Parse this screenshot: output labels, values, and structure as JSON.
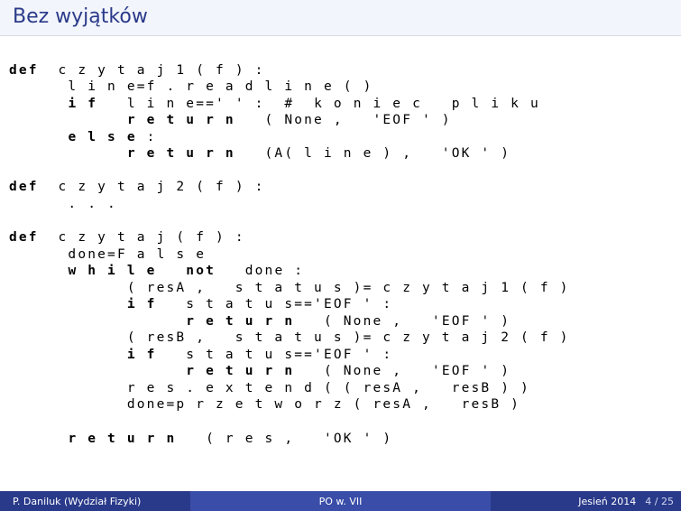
{
  "title": "Bez wyjątków",
  "code": {
    "lines": [
      "def  czytaj1 ( f ) :",
      "     line=f . readline ()",
      "     if  line=='': # koniec  pliku",
      "          return  (None ,  'EOF')",
      "     else :",
      "          return  (A( line ) ,  'OK')",
      "",
      "def  czytaj2 ( f ) :",
      "     . . .",
      "",
      "def  czytaj ( f ) :",
      "     done=False",
      "     while  not  done :",
      "          ( resA ,  status )= czytaj1 ( f )",
      "          if  status=='EOF' :",
      "               return  (None ,  'EOF')",
      "          ( resB ,  status )= czytaj2 ( f )",
      "          if  status=='EOF' :",
      "               return  (None ,  'EOF')",
      "          res . extend (( resA ,  resB ))",
      "          done=przetworz ( resA ,  resB )",
      "",
      "     return  ( res ,  'OK')"
    ]
  },
  "footer": {
    "author": "P. Daniluk (Wydział Fizyki)",
    "lecture": "PO w. VII",
    "term": "Jesień 2014",
    "page_current": "4",
    "page_total": "25"
  }
}
